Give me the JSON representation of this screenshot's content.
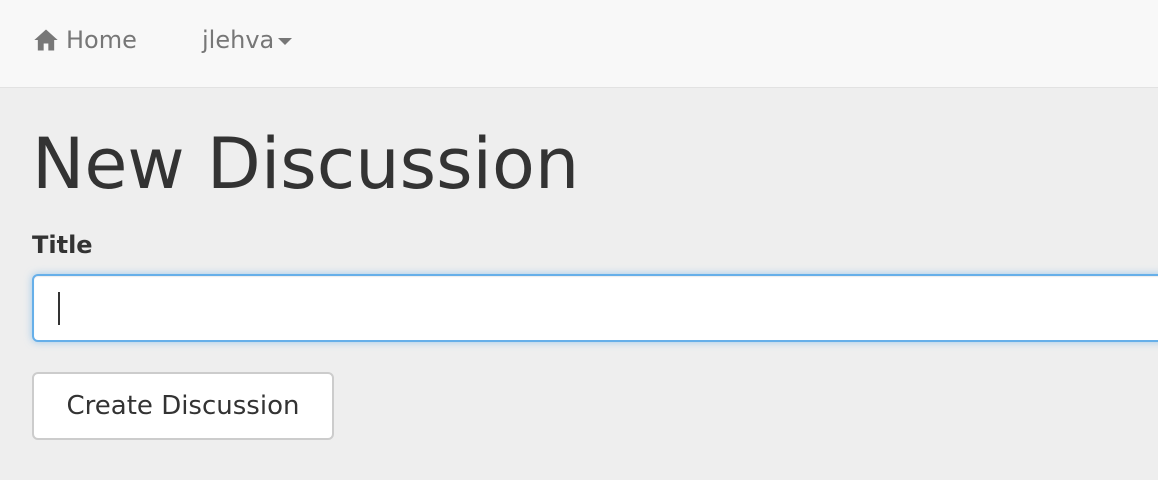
{
  "navbar": {
    "home_label": "Home",
    "home_icon": "home-icon",
    "user_label": "jlehva",
    "user_menu_icon": "caret-down-icon"
  },
  "main": {
    "page_title": "New Discussion",
    "title_field": {
      "label": "Title",
      "value": "",
      "placeholder": ""
    },
    "create_button_label": "Create Discussion"
  },
  "colors": {
    "navbar_bg": "#f8f8f8",
    "page_bg": "#eeeeee",
    "focus_border": "#66afe9",
    "nav_text": "#777777"
  }
}
